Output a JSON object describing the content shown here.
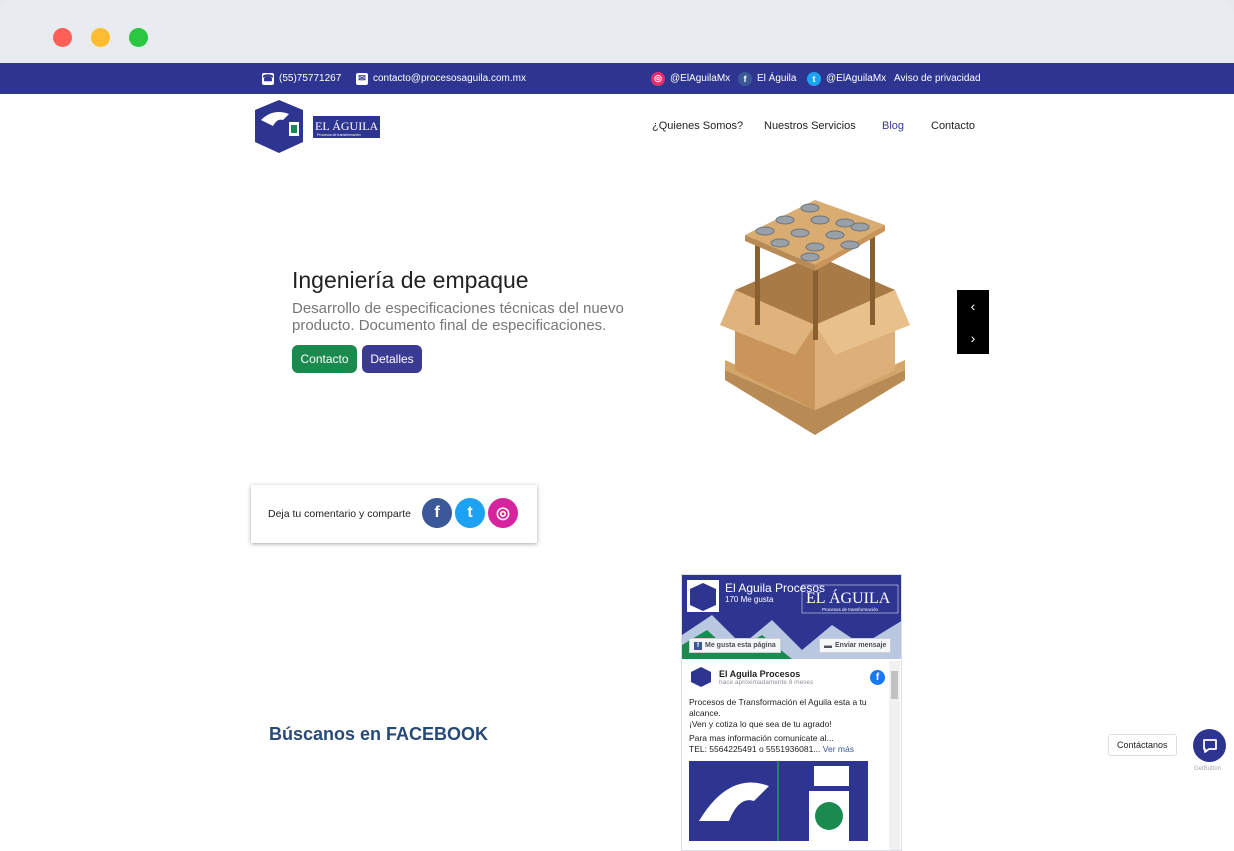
{
  "topbar": {
    "phone": "(55)75771267",
    "email": "contacto@procesosaguila.com.mx",
    "instagram": "@ElAguilaMx",
    "facebook": "El Águila",
    "twitter": "@ElAguilaMx",
    "privacy": "Aviso de privacidad"
  },
  "brand": {
    "logo_text": "EL ÁGUILA",
    "logo_tagline": "Procesos de transformación"
  },
  "nav": {
    "items": [
      "¿Quienes Somos?",
      "Nuestros Servicios",
      "Blog",
      "Contacto"
    ],
    "active": "Blog"
  },
  "hero": {
    "title": "Ingeniería de empaque",
    "subtitle": "Desarrollo de especificaciones técnicas del nuevo producto. Documento final de especificaciones.",
    "btn_contact": "Contacto",
    "btn_details": "Detalles",
    "prev": "‹",
    "next": "›"
  },
  "share": {
    "text": "Deja tu comentario y comparte"
  },
  "facebook_section": {
    "heading": "Búscanos en FACEBOOK"
  },
  "fb_widget": {
    "page_name": "El Aguila Procesos",
    "likes": "170 Me gusta",
    "cover_text": "EL ÁGUILA",
    "cover_tagline": "Procesos de transformación",
    "like_btn": "Me gusta esta página",
    "message_btn": "Enviar mensaje",
    "post_author": "El Aguila Procesos",
    "post_time": "hace aproximadamente 8 meses",
    "post_line1": "Procesos de Transformación el Aguila esta a tu alcance.",
    "post_line2": "¡Ven y cotiza lo que sea de tu agrado!",
    "post_line3": "Para mas información comunicate al...",
    "post_line4": "TEL: 5564225491 o 5551936081...",
    "see_more": "Ver más"
  },
  "contact_widget": {
    "label": "Contáctanos",
    "brand": "GetButton"
  },
  "colors": {
    "brand_blue": "#2d3590",
    "green": "#1b8a4e",
    "heading_blue": "#274a78"
  }
}
